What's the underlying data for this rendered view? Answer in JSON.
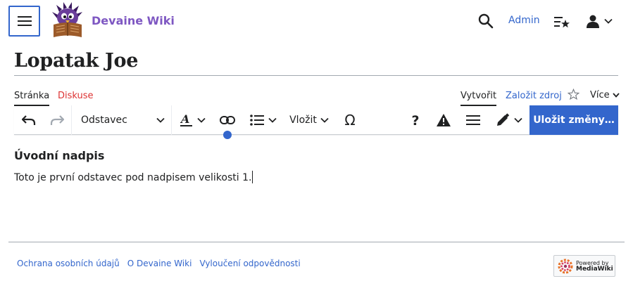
{
  "header": {
    "site_name": "Devaine Wiki",
    "user_name": "Admin",
    "icons": [
      "menu-icon",
      "logo",
      "search-icon",
      "watchlist-icon",
      "user-icon",
      "chevron-down-icon"
    ]
  },
  "page": {
    "title": "Lopatak Joe"
  },
  "tabs": {
    "page": "Stránka",
    "talk": "Diskuse",
    "create": "Vytvořit",
    "create_source": "Založit zdroj",
    "more": "Více"
  },
  "toolbar": {
    "paragraph_format": "Odstavec",
    "insert": "Vložit",
    "save": "Uložit změny…",
    "icons": [
      "undo-icon",
      "redo-icon",
      "text-style-icon",
      "link-icon",
      "list-icon",
      "special-character-icon",
      "help-icon",
      "notices-icon",
      "page-options-icon",
      "edit-mode-icon"
    ]
  },
  "content": {
    "heading": "Úvodní nadpis",
    "paragraph": "Toto je první odstavec pod nadpisem velikosti 1."
  },
  "footer": {
    "links": [
      "Ochrana osobních údajů",
      "O Devaine Wiki",
      "Vyloučení odpovědnosti"
    ],
    "powered_line1": "Powered by",
    "powered_line2": "MediaWiki"
  },
  "colors": {
    "accent": "#3366cc",
    "site_name": "#7e57c2",
    "talk_tab": "#dd3333"
  }
}
